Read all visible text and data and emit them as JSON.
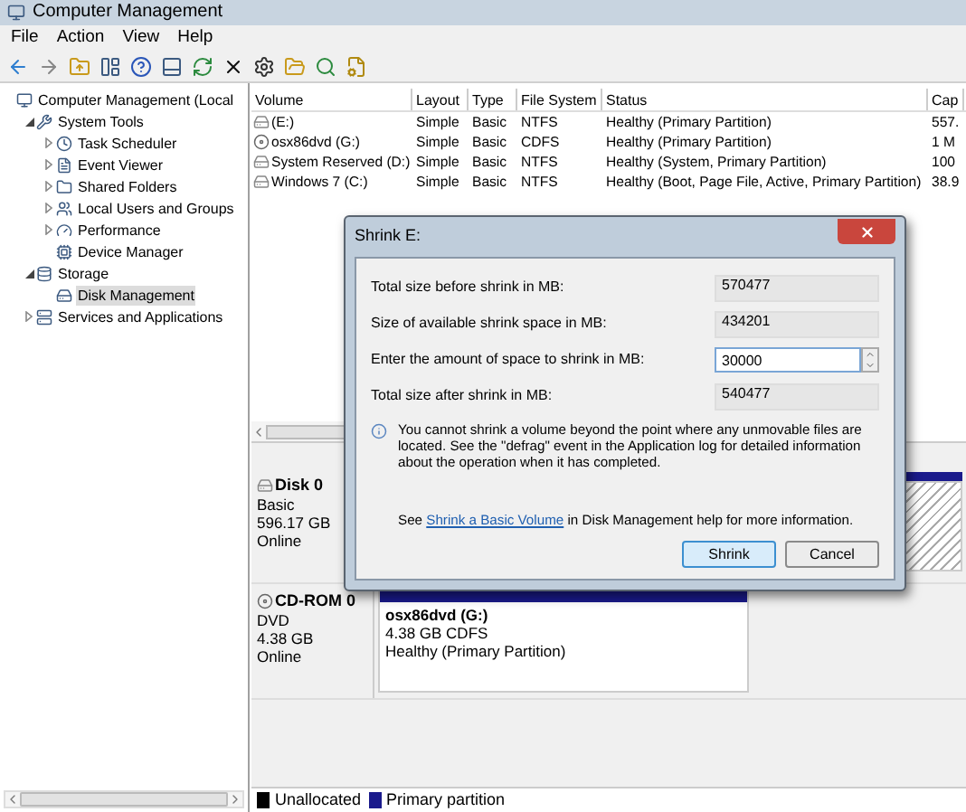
{
  "window": {
    "title": "Computer Management"
  },
  "menu": [
    "File",
    "Action",
    "View",
    "Help"
  ],
  "tree": [
    {
      "label": "Computer Management (Local",
      "kind": "root",
      "selected": false,
      "children": [
        {
          "label": "System Tools",
          "kind": "branch",
          "expanded": true,
          "selected": false,
          "children": [
            {
              "label": "Task Scheduler",
              "kind": "branch",
              "expanded": false,
              "selected": false
            },
            {
              "label": "Event Viewer",
              "kind": "branch",
              "expanded": false,
              "selected": false
            },
            {
              "label": "Shared Folders",
              "kind": "branch",
              "expanded": false,
              "selected": false
            },
            {
              "label": "Local Users and Groups",
              "kind": "branch",
              "expanded": false,
              "selected": false
            },
            {
              "label": "Performance",
              "kind": "branch",
              "expanded": false,
              "selected": false
            },
            {
              "label": "Device Manager",
              "kind": "leaf",
              "selected": false
            }
          ]
        },
        {
          "label": "Storage",
          "kind": "branch",
          "expanded": true,
          "selected": false,
          "children": [
            {
              "label": "Disk Management",
              "kind": "leaf",
              "selected": true
            }
          ]
        },
        {
          "label": "Services and Applications",
          "kind": "branch",
          "expanded": false,
          "selected": false
        }
      ]
    }
  ],
  "table": {
    "columns": [
      "Volume",
      "Layout",
      "Type",
      "File System",
      "Status",
      "Cap"
    ],
    "rows": [
      {
        "kind": "disk",
        "cells": [
          "(E:)",
          "Simple",
          "Basic",
          "NTFS",
          "Healthy (Primary Partition)",
          "557."
        ]
      },
      {
        "kind": "cd",
        "cells": [
          "osx86dvd (G:)",
          "Simple",
          "Basic",
          "CDFS",
          "Healthy (Primary Partition)",
          "1 M"
        ]
      },
      {
        "kind": "disk",
        "cells": [
          "System Reserved (D:)",
          "Simple",
          "Basic",
          "NTFS",
          "Healthy (System, Primary Partition)",
          "100"
        ]
      },
      {
        "kind": "disk",
        "cells": [
          "Windows 7 (C:)",
          "Simple",
          "Basic",
          "NTFS",
          "Healthy (Boot, Page File, Active, Primary Partition)",
          "38.9"
        ]
      }
    ]
  },
  "disks": [
    {
      "kind": "disk",
      "name": "Disk 0",
      "lines": [
        "Basic",
        "596.17 GB",
        "Online"
      ]
    },
    {
      "kind": "cd",
      "name": "CD-ROM 0",
      "lines": [
        "DVD",
        "4.38 GB",
        "Online"
      ],
      "partitions": [
        {
          "name": "osx86dvd  (G:)",
          "lines": [
            "4.38 GB CDFS",
            "Healthy (Primary Partition)"
          ]
        }
      ]
    }
  ],
  "legend": [
    {
      "label": "Unallocated",
      "color": "#000000"
    },
    {
      "label": "Primary partition",
      "color": "#1a1a8c"
    }
  ],
  "dialog": {
    "title": "Shrink E:",
    "fields": [
      {
        "kind": "readonly",
        "label": "Total size before shrink in MB:",
        "value": "570477"
      },
      {
        "kind": "readonly",
        "label": "Size of available shrink space in MB:",
        "value": "434201"
      },
      {
        "kind": "spin",
        "label": "Enter the amount of space to shrink in MB:",
        "value": "30000"
      },
      {
        "kind": "readonly",
        "label": "Total size after shrink in MB:",
        "value": "540477"
      }
    ],
    "info": "You cannot shrink a volume beyond the point where any unmovable files are located. See the \"defrag\" event in the Application log for detailed information about the operation when it has completed.",
    "help": {
      "before": "See",
      "link": "Shrink a Basic Volume",
      "after": "in Disk Management help for more information."
    },
    "buttons": [
      {
        "label": "Shrink",
        "default": true
      },
      {
        "label": "Cancel",
        "default": false
      }
    ]
  }
}
